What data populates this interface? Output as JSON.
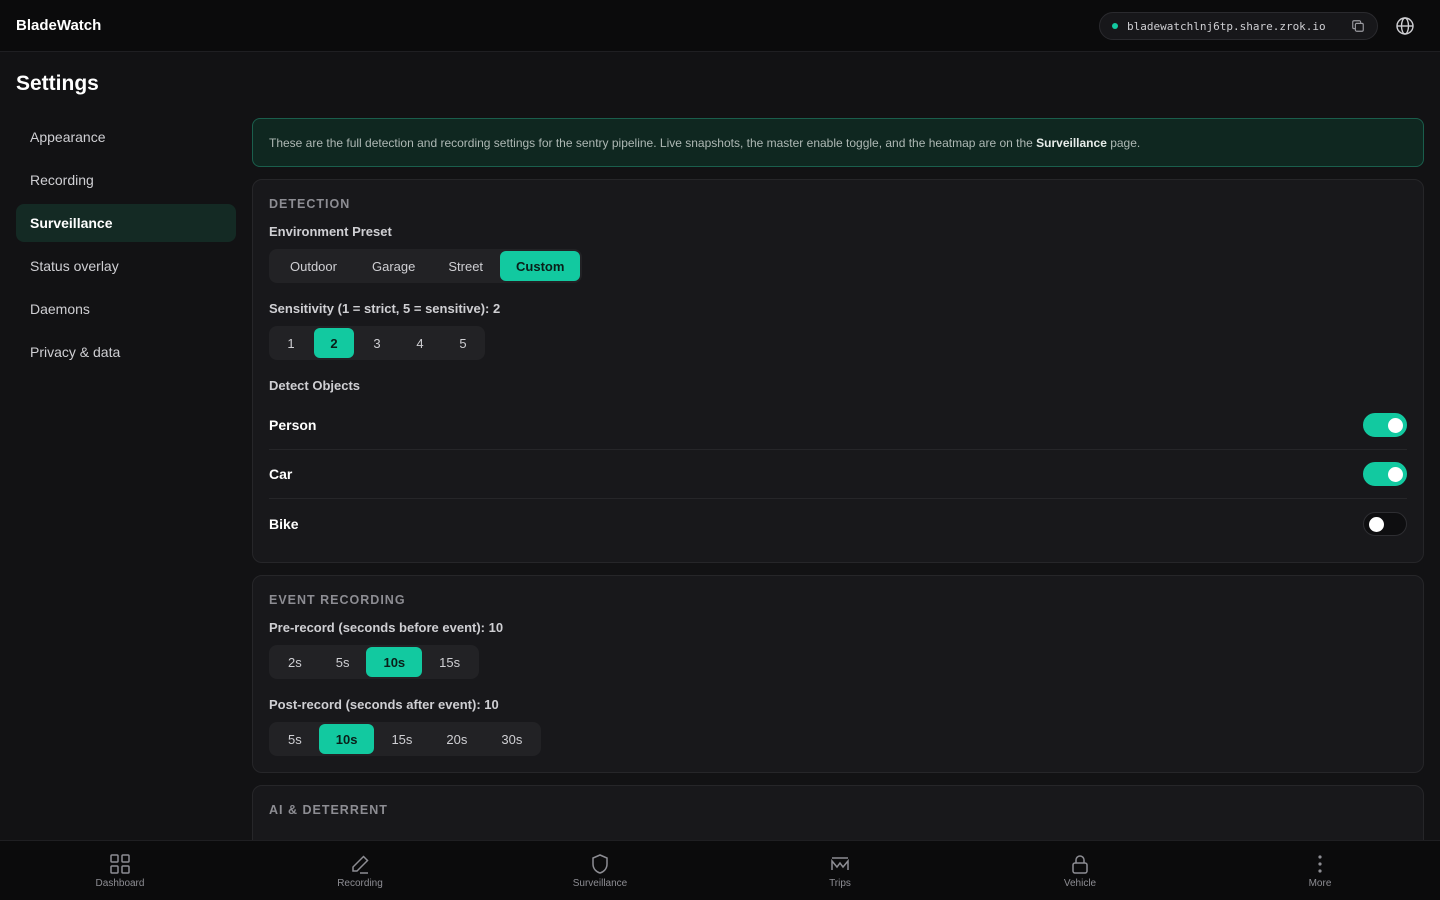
{
  "app": {
    "title": "BladeWatch"
  },
  "share": {
    "url": "bladewatchlnj6tp.share.zrok.io",
    "status_color": "#12c9a0"
  },
  "page": {
    "title": "Settings"
  },
  "sidebar": {
    "items": [
      {
        "label": "Appearance",
        "active": false
      },
      {
        "label": "Recording",
        "active": false
      },
      {
        "label": "Surveillance",
        "active": true
      },
      {
        "label": "Status overlay",
        "active": false
      },
      {
        "label": "Daemons",
        "active": false
      },
      {
        "label": "Privacy & data",
        "active": false
      }
    ]
  },
  "info": {
    "text_before": "These are the full detection and recording settings for the sentry pipeline. Live snapshots, the master enable toggle, and the heatmap are on the ",
    "bold": "Surveillance",
    "text_after": " page."
  },
  "detection": {
    "title": "Detection",
    "preset_label": "Environment Preset",
    "presets": [
      "Outdoor",
      "Garage",
      "Street",
      "Custom"
    ],
    "preset_selected": "Custom",
    "sensitivity_label": "Sensitivity (1 = strict, 5 = sensitive): 2",
    "sensitivity_options": [
      "1",
      "2",
      "3",
      "4",
      "5"
    ],
    "sensitivity_selected": "2",
    "objects_label": "Detect Objects",
    "objects": [
      {
        "label": "Person",
        "enabled": true
      },
      {
        "label": "Car",
        "enabled": true
      },
      {
        "label": "Bike",
        "enabled": false
      }
    ]
  },
  "event_recording": {
    "title": "Event Recording",
    "pre_label": "Pre-record (seconds before event): 10",
    "pre_options": [
      "2s",
      "5s",
      "10s",
      "15s"
    ],
    "pre_selected": "10s",
    "post_label": "Post-record (seconds after event): 10",
    "post_options": [
      "5s",
      "10s",
      "15s",
      "20s",
      "30s"
    ],
    "post_selected": "10s"
  },
  "ai_deterrent": {
    "title": "AI & Deterrent"
  },
  "bottom_nav": {
    "items": [
      {
        "label": "Dashboard",
        "icon": "grid-icon"
      },
      {
        "label": "Recording",
        "icon": "pen-icon"
      },
      {
        "label": "Surveillance",
        "icon": "shield-icon"
      },
      {
        "label": "Trips",
        "icon": "route-icon"
      },
      {
        "label": "Vehicle",
        "icon": "lock-icon"
      },
      {
        "label": "More",
        "icon": "more-icon"
      }
    ]
  },
  "colors": {
    "accent": "#12c9a0",
    "background": "#121214"
  }
}
